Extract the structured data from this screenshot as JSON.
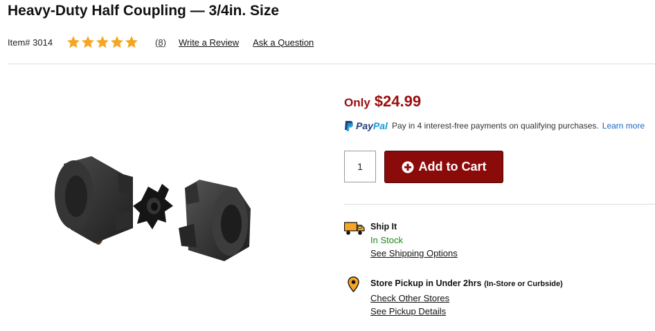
{
  "product": {
    "title": "Heavy-Duty Half Coupling — 3/4in. Size",
    "item_number": "Item# 3014",
    "rating": 5,
    "rating_max": 5,
    "review_count": "(8)",
    "write_review": "Write a Review",
    "ask_question": "Ask a Question"
  },
  "pricing": {
    "prefix": "Only",
    "price": "$24.99",
    "color": "#9b0d0d"
  },
  "paypal": {
    "logo_pay": "Pay",
    "logo_pal": "Pal",
    "message": "Pay in 4 interest-free payments on qualifying purchases.",
    "learn_more": "Learn more"
  },
  "cart": {
    "quantity": "1",
    "button_label": "Add to Cart",
    "button_color": "#8b0a0a",
    "button_icon": "plus-circle-icon"
  },
  "shipping": {
    "icon": "truck-icon",
    "title": "Ship It",
    "status": "In Stock",
    "status_color": "#1a8a1a",
    "link": "See Shipping Options"
  },
  "pickup": {
    "icon": "location-pin-icon",
    "title": "Store Pickup in Under 2hrs",
    "subtitle": "(In-Store or Curbside)",
    "link_stores": "Check Other Stores",
    "link_details": "See Pickup Details"
  },
  "colors": {
    "star": "#f5a623",
    "link_blue": "#1a66c2"
  }
}
